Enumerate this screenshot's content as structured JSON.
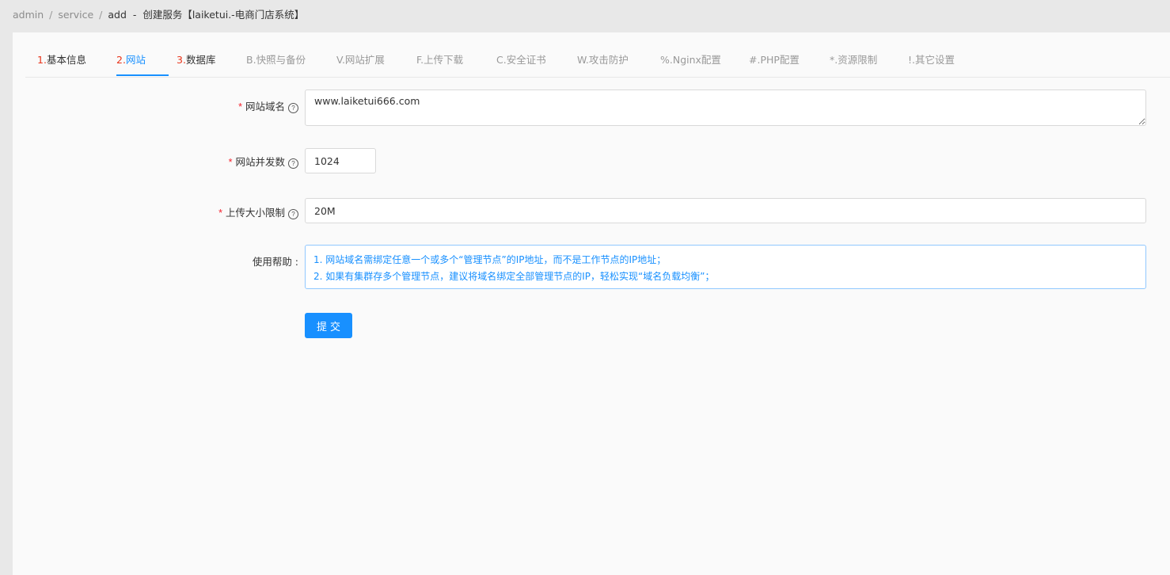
{
  "breadcrumb": {
    "items": [
      "admin",
      "service"
    ],
    "separator": "/",
    "current": "add  -  创建服务【laiketui.-电商门店系统】"
  },
  "tabs": [
    {
      "prefix": "1.",
      "label": "基本信息",
      "prefix_red": true,
      "state": "enabled"
    },
    {
      "prefix": "2.",
      "label": "网站",
      "prefix_red": true,
      "state": "active"
    },
    {
      "prefix": "3.",
      "label": "数据库",
      "prefix_red": true,
      "state": "enabled"
    },
    {
      "prefix": "B.",
      "label": "快照与备份",
      "prefix_red": false,
      "state": "disabled"
    },
    {
      "prefix": "V.",
      "label": "网站扩展",
      "prefix_red": false,
      "state": "disabled"
    },
    {
      "prefix": "F.",
      "label": "上传下载",
      "prefix_red": false,
      "state": "disabled"
    },
    {
      "prefix": "C.",
      "label": "安全证书",
      "prefix_red": false,
      "state": "disabled"
    },
    {
      "prefix": "W.",
      "label": "攻击防护",
      "prefix_red": false,
      "state": "disabled"
    },
    {
      "prefix": "%.",
      "label": "Nginx配置",
      "prefix_red": false,
      "state": "disabled"
    },
    {
      "prefix": "#.",
      "label": "PHP配置",
      "prefix_red": false,
      "state": "disabled"
    },
    {
      "prefix": "*.",
      "label": "资源限制",
      "prefix_red": false,
      "state": "disabled"
    },
    {
      "prefix": "!.",
      "label": "其它设置",
      "prefix_red": false,
      "state": "disabled"
    }
  ],
  "form": {
    "domain": {
      "required_mark": "*",
      "label": "网站域名",
      "value": "www.laiketui666.com"
    },
    "concurrency": {
      "required_mark": "*",
      "label": "网站并发数",
      "value": "1024"
    },
    "upload_limit": {
      "required_mark": "*",
      "label": "上传大小限制",
      "value": "20M"
    },
    "help": {
      "label": "使用帮助 :",
      "lines": [
        "1. 网站域名需绑定任意一个或多个“管理节点”的IP地址，而不是工作节点的IP地址；",
        "2. 如果有集群存多个管理节点，建议将域名绑定全部管理节点的IP，轻松实现“域名负载均衡”；"
      ]
    },
    "submit_label": "提交"
  },
  "icons": {
    "help": "question-circle-icon"
  },
  "colors": {
    "primary": "#1890ff",
    "required": "#f5222d",
    "tab_number": "#e8341a",
    "alert_border": "#91c8ff"
  }
}
